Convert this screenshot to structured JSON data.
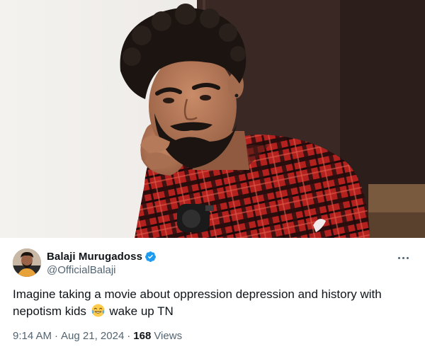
{
  "photo": {
    "icon": "man-portrait-photo"
  },
  "tweet": {
    "author": {
      "display_name": "Balaji Murugadoss",
      "handle": "@OfficialBalaji",
      "verified": true,
      "verified_color": "#1d9bf0",
      "avatar_icon": "avatar-photo"
    },
    "more_icon": "more-options-icon",
    "text_before_emoji": "Imagine taking a movie about oppression depression and history with nepotism kids",
    "emoji": "face-with-tears-of-joy",
    "text_after_emoji": "wake up TN",
    "time": "9:14 AM",
    "separator": "·",
    "date": "Aug 21, 2024",
    "views_count": "168",
    "views_label": "Views"
  },
  "colors": {
    "text_primary": "#0f1419",
    "text_secondary": "#536471",
    "accent": "#1d9bf0"
  }
}
